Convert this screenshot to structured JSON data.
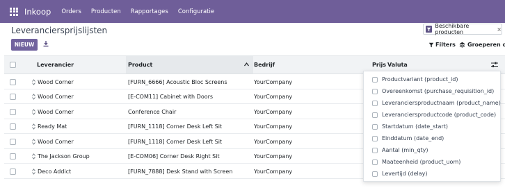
{
  "navbar": {
    "app_name": "Inkoop",
    "menu": [
      "Orders",
      "Producten",
      "Rapportages",
      "Configuratie"
    ]
  },
  "control_panel": {
    "title": "Leveranciersprijslijsten",
    "facet_label": "Beschikbare producten",
    "facet_close": "×",
    "new_button": "NIEUW",
    "filters_label": "Filters",
    "groupby_label": "Groeperen op"
  },
  "table": {
    "headers": {
      "vendor": "Leverancier",
      "product": "Product",
      "company": "Bedrijf",
      "price": "Prijs",
      "currency": "Valuta"
    },
    "rows": [
      {
        "vendor": "Wood Corner",
        "product": "[FURN_6666] Acoustic Bloc Screens",
        "company": "YourCompany"
      },
      {
        "vendor": "Wood Corner",
        "product": "[E-COM11] Cabinet with Doors",
        "company": "YourCompany"
      },
      {
        "vendor": "Wood Corner",
        "product": "Conference Chair",
        "company": "YourCompany"
      },
      {
        "vendor": "Ready Mat",
        "product": "[FURN_1118] Corner Desk Left Sit",
        "company": "YourCompany"
      },
      {
        "vendor": "Wood Corner",
        "product": "[FURN_1118] Corner Desk Left Sit",
        "company": "YourCompany"
      },
      {
        "vendor": "The Jackson Group",
        "product": "[E-COM06] Corner Desk Right Sit",
        "company": "YourCompany"
      },
      {
        "vendor": "Deco Addict",
        "product": "[FURN_7888] Desk Stand with Screen",
        "company": "YourCompany"
      }
    ]
  },
  "optional_columns": [
    "Productvariant (product_id)",
    "Overeenkomst (purchase_requisition_id)",
    "Leveranciersproductnaam (product_name)",
    "Leveranciersproductcode (product_code)",
    "Startdatum (date_start)",
    "Einddatum (date_end)",
    "Aantal (min_qty)",
    "Maateenheid (product_uom)",
    "Levertijd (delay)"
  ],
  "colors": {
    "navbar": "#6f5e99",
    "primary_button": "#71639e"
  }
}
